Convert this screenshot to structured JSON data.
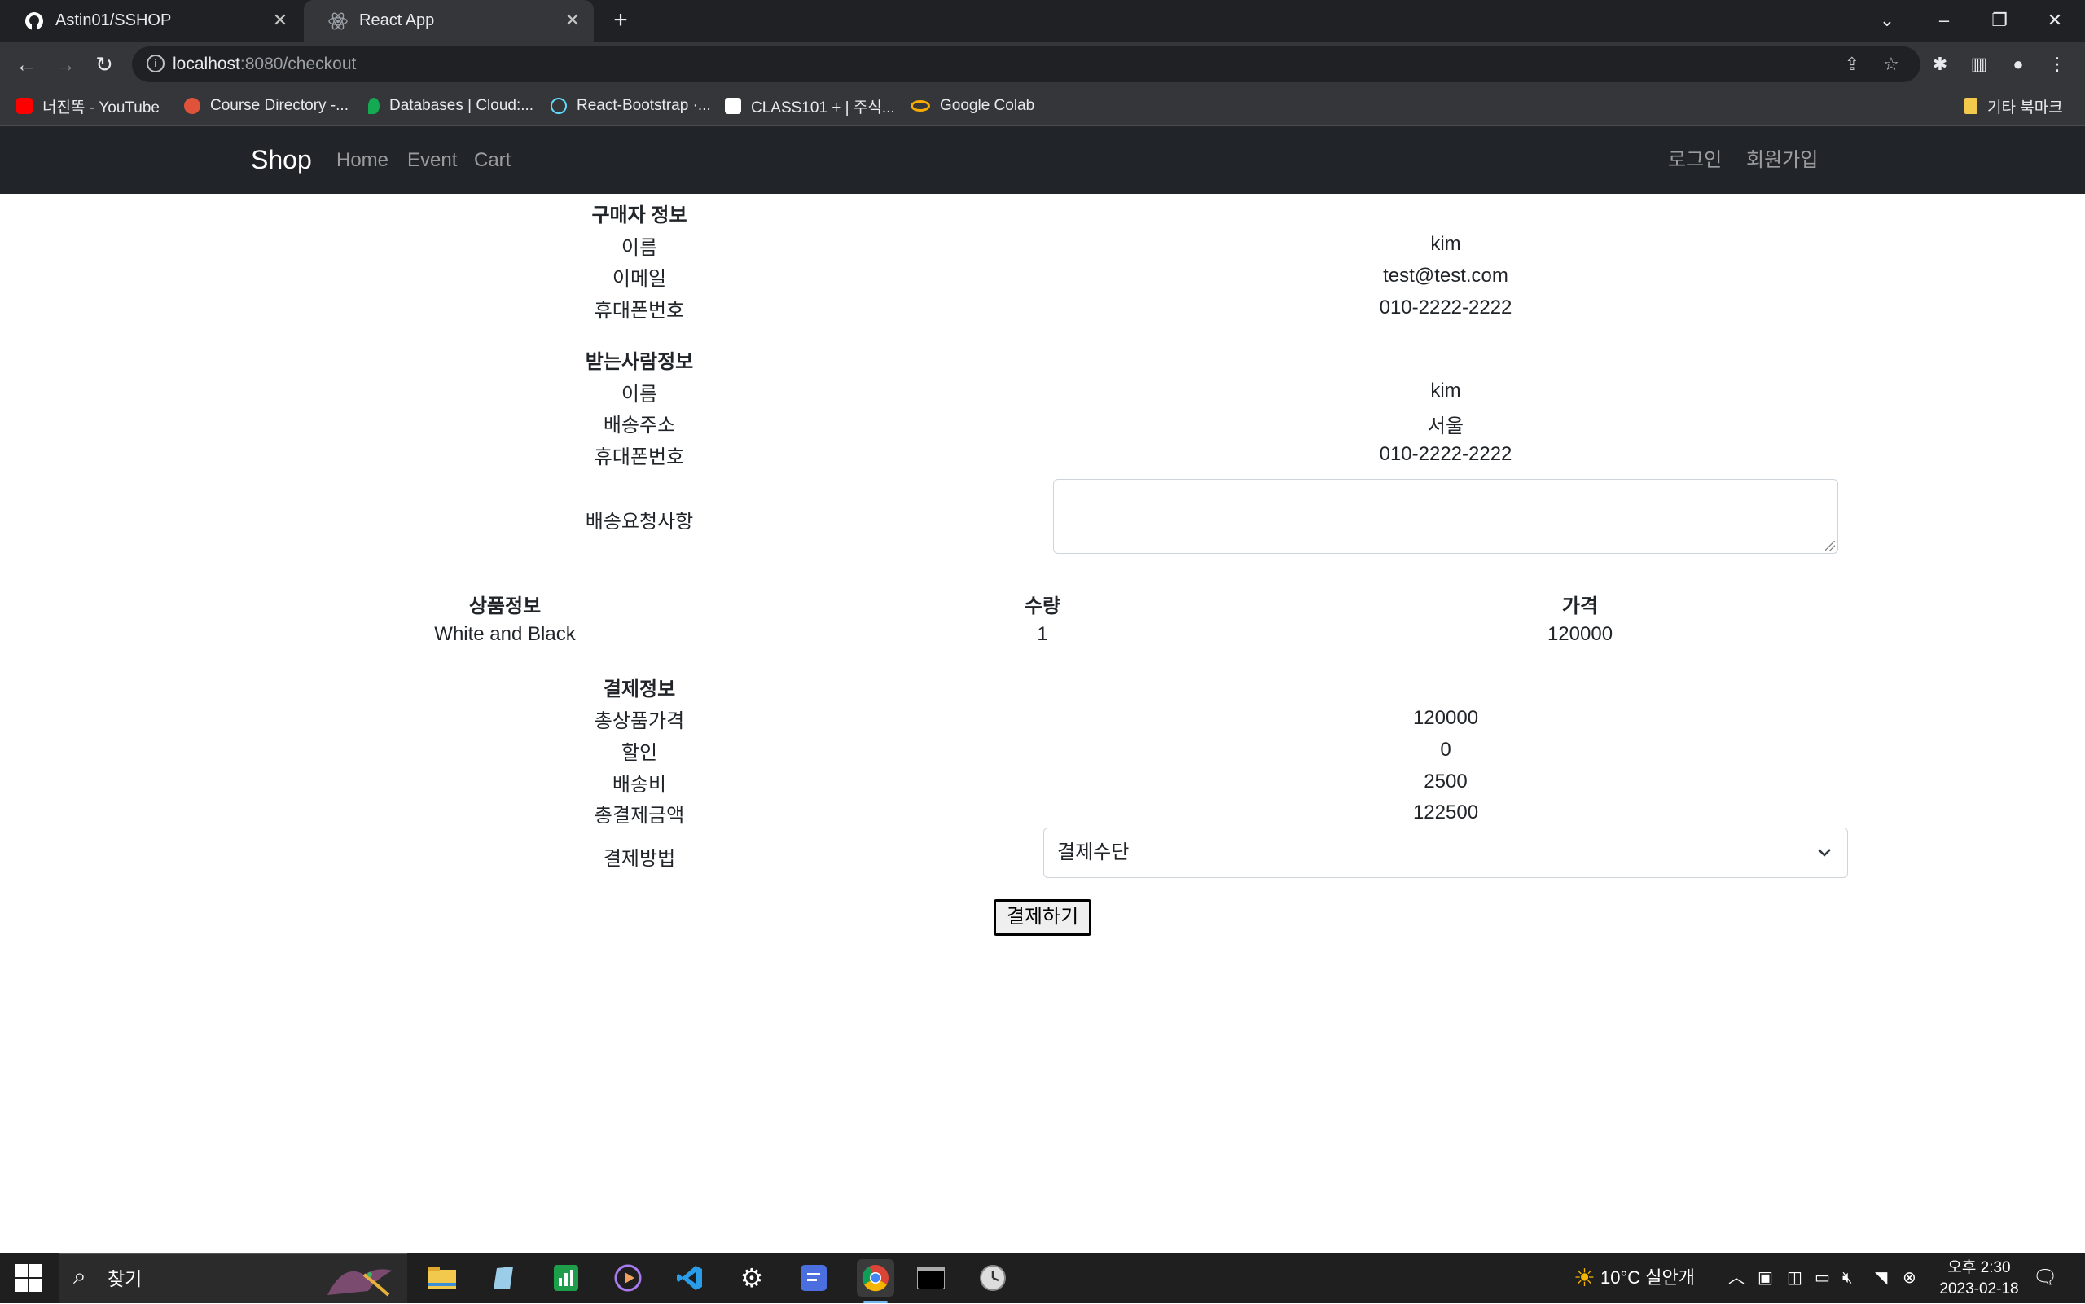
{
  "browser": {
    "tabs": [
      {
        "title": "Astin01/SSHOP",
        "icon": "github-icon"
      },
      {
        "title": "React App",
        "icon": "react-icon"
      }
    ],
    "url_host": "localhost",
    "url_path": ":8080/checkout",
    "bookmarks": [
      {
        "label": "너진똑 - YouTube",
        "icon": "youtube-icon",
        "color": "#ff0000"
      },
      {
        "label": "Course Directory -...",
        "icon": "apple-icon",
        "color": "#e0533a"
      },
      {
        "label": "Databases | Cloud:...",
        "icon": "mongodb-leaf-icon",
        "color": "#13aa52"
      },
      {
        "label": "React-Bootstrap ·...",
        "icon": "react-icon",
        "color": "#61dafb"
      },
      {
        "label": "CLASS101 + | 주식...",
        "icon": "class101-icon",
        "color": "#ffffff"
      },
      {
        "label": "Google Colab",
        "icon": "colab-icon",
        "color": "#f9ab00"
      }
    ],
    "other_bookmarks": "기타 북마크"
  },
  "navbar": {
    "brand": "Shop",
    "links": [
      "Home",
      "Event",
      "Cart"
    ],
    "login": "로그인",
    "signup": "회원가입"
  },
  "buyer": {
    "heading": "구매자 정보",
    "name_label": "이름",
    "name": "kim",
    "email_label": "이메일",
    "email": "test@test.com",
    "phone_label": "휴대폰번호",
    "phone": "010-2222-2222"
  },
  "recipient": {
    "heading": "받는사람정보",
    "name_label": "이름",
    "name": "kim",
    "address_label": "배송주소",
    "address": "서울",
    "phone_label": "휴대폰번호",
    "phone": "010-2222-2222",
    "request_label": "배송요청사항",
    "request_value": ""
  },
  "products": {
    "headers": [
      "상품정보",
      "수량",
      "가격"
    ],
    "rows": [
      [
        "White and Black",
        "1",
        "120000"
      ]
    ]
  },
  "payment": {
    "heading": "결제정보",
    "subtotal_label": "총상품가격",
    "subtotal": "120000",
    "discount_label": "할인",
    "discount": "0",
    "shipping_label": "배송비",
    "shipping": "2500",
    "total_label": "총결제금액",
    "total": "122500",
    "method_label": "결제방법",
    "method_selected": "결제수단",
    "pay_button": "결제하기"
  },
  "taskbar": {
    "search_text": "찾기",
    "weather": "10°C  실안개",
    "time": "오후 2:30",
    "date": "2023-02-18"
  }
}
